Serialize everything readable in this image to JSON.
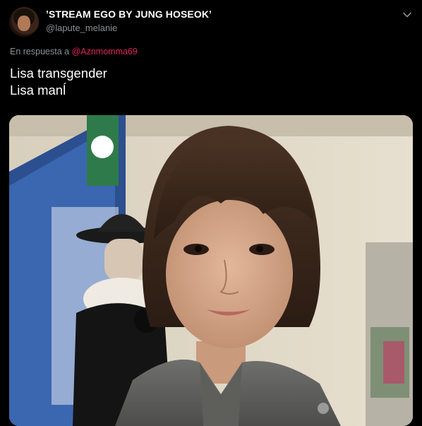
{
  "tweet": {
    "display_name": "ʼSTREAM EGO BY JUNG HOSEOKʼ",
    "handle": "@lapute_melanie",
    "reply_prefix": "En respuesta a",
    "reply_mention": "@Aznmomma69",
    "text_lines": [
      "Lisa transgender",
      "Lisa manĺ"
    ],
    "media_alt": "Photo of a person with a short dark bob haircut in a store"
  },
  "colors": {
    "background": "#000000",
    "text_primary": "#ffffff",
    "text_secondary": "#8a8f94",
    "mention": "#e0245e"
  },
  "icons": {
    "more": "chevron-down-icon"
  }
}
